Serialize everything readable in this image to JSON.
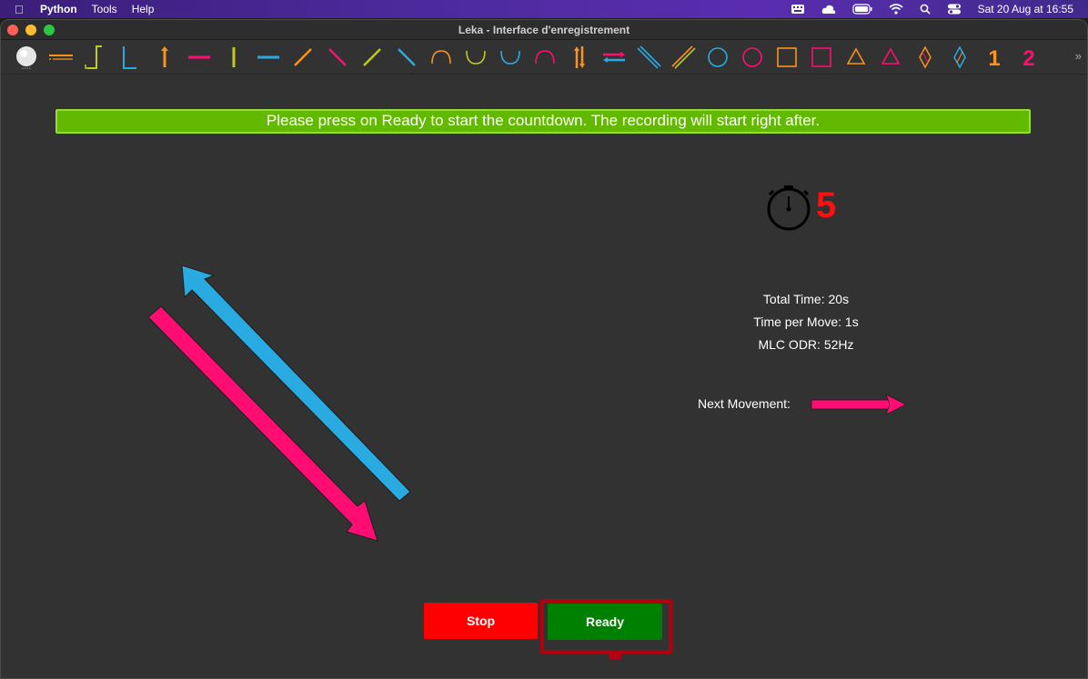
{
  "menubar": {
    "apple_icon": "apple-icon",
    "app_name": "Python",
    "menus": [
      "Tools",
      "Help"
    ],
    "status_icons": [
      "keyboard-icon",
      "cloud-icon",
      "battery-icon",
      "wifi-icon",
      "search-icon",
      "control-center-icon"
    ],
    "datetime": "Sat 20 Aug at  16:55"
  },
  "window": {
    "title": "Leka - Interface d'enregistrement",
    "traffic_colors": [
      "#ff5f57",
      "#febc2e",
      "#28c840"
    ]
  },
  "toolbar": {
    "icons": [
      {
        "name": "leka-robot-icon",
        "color": "#e6e6e6"
      },
      {
        "name": "stripe-lines-icon",
        "color": "#f7931e"
      },
      {
        "name": "l-shape-yellow-icon",
        "color": "#c0ca1e"
      },
      {
        "name": "l-shape-blue-icon",
        "color": "#29abe2"
      },
      {
        "name": "arrow-up-orange-icon",
        "color": "#f7931e"
      },
      {
        "name": "horizontal-line-pink-icon",
        "color": "#ff0d72"
      },
      {
        "name": "vertical-line-yellow-icon",
        "color": "#c0ca1e"
      },
      {
        "name": "horizontal-line-blue-icon",
        "color": "#29abe2"
      },
      {
        "name": "diagonal-orange-icon",
        "color": "#f7931e"
      },
      {
        "name": "diagonal-pink-icon",
        "color": "#ff0d72"
      },
      {
        "name": "diagonal-yellow-icon",
        "color": "#c0ca1e"
      },
      {
        "name": "diagonal-blue-icon",
        "color": "#29abe2"
      },
      {
        "name": "arc-up-orange-icon",
        "color": "#f7931e"
      },
      {
        "name": "arc-down-yellow-icon",
        "color": "#c0ca1e"
      },
      {
        "name": "arc-down-blue-icon",
        "color": "#29abe2"
      },
      {
        "name": "arc-up-pink-icon",
        "color": "#ff0d72"
      },
      {
        "name": "double-vertical-arrows-icon",
        "color": "#f7931e"
      },
      {
        "name": "double-horizontal-arrows-icon",
        "color": "#ff0d72"
      },
      {
        "name": "double-diagonal-blue-icon",
        "color": "#29abe2"
      },
      {
        "name": "double-diagonal-orange-icon",
        "color": "#f7931e"
      },
      {
        "name": "circle-blue-icon",
        "color": "#29abe2"
      },
      {
        "name": "circle-pink-icon",
        "color": "#ff0d72"
      },
      {
        "name": "square-orange-icon",
        "color": "#f7931e"
      },
      {
        "name": "square-pink-icon",
        "color": "#ff0d72"
      },
      {
        "name": "triangle-yellow-icon",
        "color": "#f7931e"
      },
      {
        "name": "triangle-pink-icon",
        "color": "#ff0d72"
      },
      {
        "name": "diamond-orange-icon",
        "color": "#f7931e"
      },
      {
        "name": "diamond-blue-icon",
        "color": "#29abe2"
      },
      {
        "name": "digit-one-icon",
        "color": "#f7931e",
        "text": "1"
      },
      {
        "name": "digit-two-icon",
        "color": "#ff0d72",
        "text": "2"
      }
    ],
    "more_icon": "»"
  },
  "main": {
    "banner": "Please press on Ready to start the countdown. The recording will start right after.",
    "countdown": "5",
    "total_time": "Total Time: 20s",
    "time_per_move": "Time per Move: 1s",
    "mlc_odr": "MLC ODR: 52Hz",
    "next_movement_label": "Next Movement:",
    "stop_label": "Stop",
    "ready_label": "Ready"
  },
  "colors": {
    "pink": "#ff0d72",
    "blue": "#29abe2",
    "banner_bg": "#63b800",
    "stop_bg": "#ff0000",
    "ready_bg": "#008000",
    "countdown": "#ff1010"
  }
}
